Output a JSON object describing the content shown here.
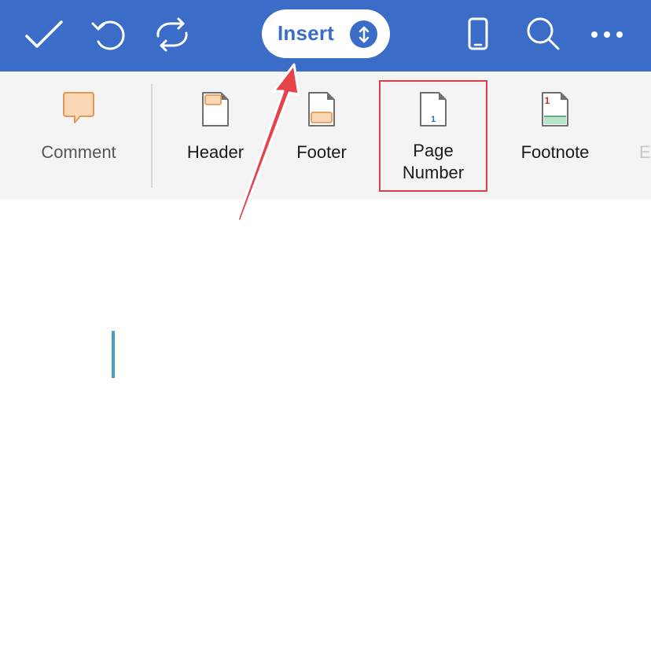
{
  "toolbar": {
    "active_tab_label": "Insert",
    "icons": [
      "checkmark-icon",
      "undo-icon",
      "sync-icon",
      "phone-view-icon",
      "search-icon",
      "more-icon"
    ]
  },
  "ribbon": {
    "items": [
      {
        "label": "Comment",
        "icon": "comment-icon"
      },
      {
        "label": "Header",
        "icon": "header-icon"
      },
      {
        "label": "Footer",
        "icon": "footer-icon"
      },
      {
        "label_line1": "Page",
        "label_line2": "Number",
        "icon": "page-number-icon",
        "glyph": "1"
      },
      {
        "label": "Footnote",
        "icon": "footnote-icon",
        "glyph": "1"
      },
      {
        "label": "E",
        "icon": "truncated-item"
      }
    ]
  },
  "colors": {
    "toolbar_bg": "#3a6cc8",
    "ribbon_bg": "#f4f4f4",
    "highlight_border": "#d9404a",
    "annotation_arrow": "#e8434b",
    "caret": "#4a9bc0"
  }
}
